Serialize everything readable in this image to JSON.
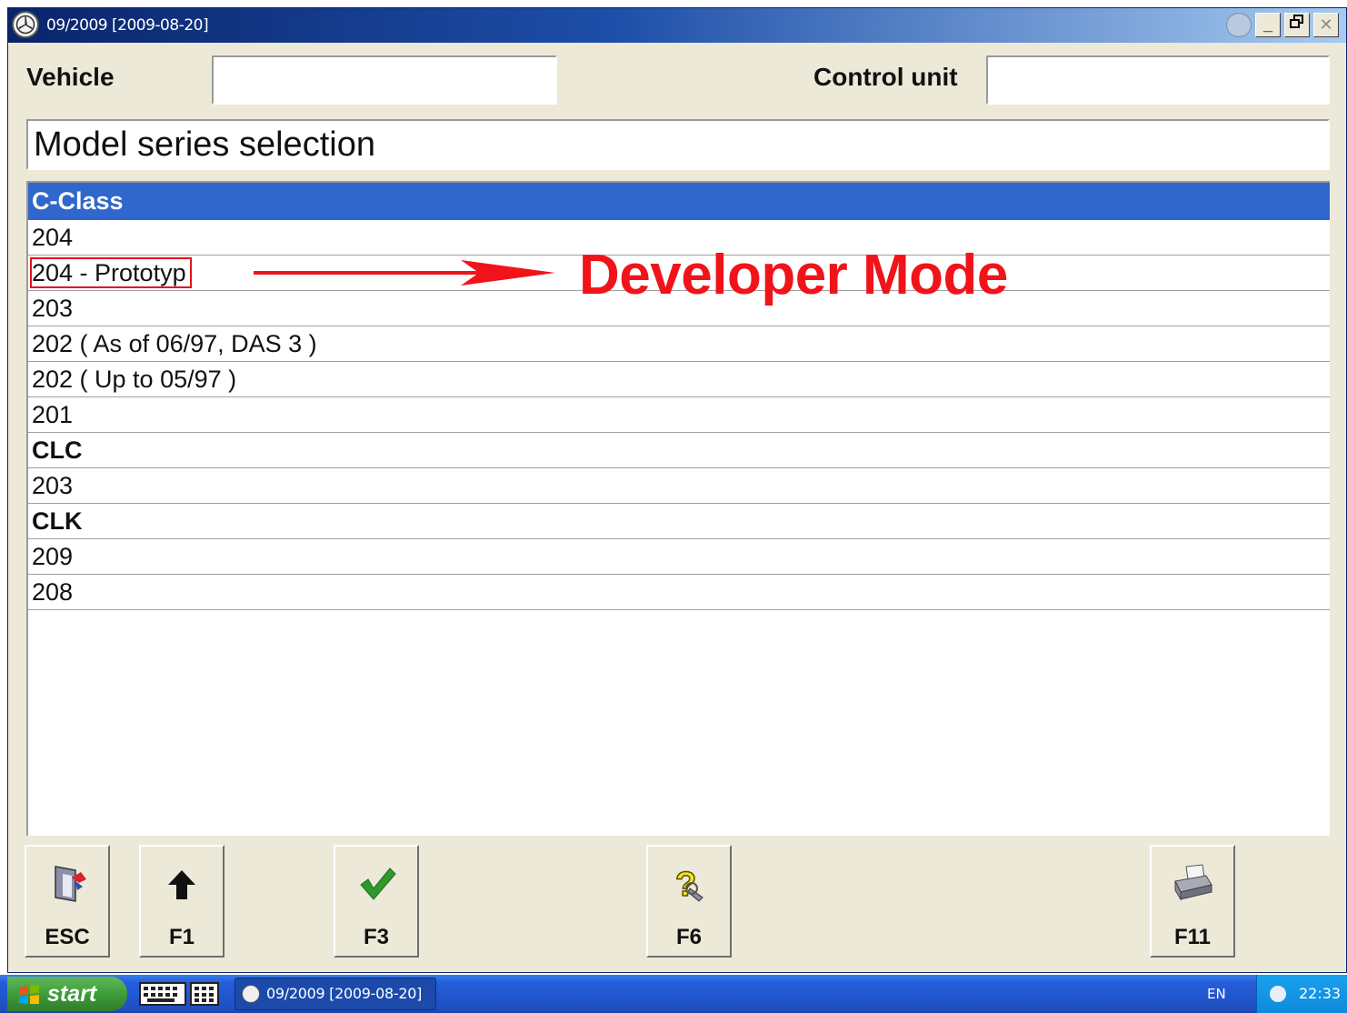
{
  "window": {
    "title": "09/2009 [2009-08-20]"
  },
  "header": {
    "vehicle_label": "Vehicle",
    "vehicle_value": "",
    "control_unit_label": "Control unit",
    "control_unit_value": ""
  },
  "heading": "Model series selection",
  "list": {
    "items": [
      {
        "label": "C-Class",
        "type": "group",
        "selected": true
      },
      {
        "label": "204",
        "type": "item"
      },
      {
        "label": "204 - Prototyp",
        "type": "item",
        "highlighted": true
      },
      {
        "label": "203",
        "type": "item"
      },
      {
        "label": "202 ( As of 06/97, DAS 3 )",
        "type": "item"
      },
      {
        "label": "202 ( Up to 05/97 )",
        "type": "item"
      },
      {
        "label": "201",
        "type": "item"
      },
      {
        "label": "CLC",
        "type": "group"
      },
      {
        "label": "203",
        "type": "item"
      },
      {
        "label": "CLK",
        "type": "group"
      },
      {
        "label": "209",
        "type": "item"
      },
      {
        "label": "208",
        "type": "item"
      }
    ]
  },
  "annotation": {
    "text": "Developer Mode",
    "color": "#f0141a"
  },
  "function_keys": [
    {
      "label": "ESC",
      "icon": "exit-door-icon"
    },
    {
      "label": "F1",
      "icon": "up-arrow-icon"
    },
    {
      "label": "F3",
      "icon": "checkmark-icon"
    },
    {
      "label": "F6",
      "icon": "help-question-icon"
    },
    {
      "label": "F11",
      "icon": "printer-icon"
    }
  ],
  "taskbar": {
    "start_label": "start",
    "task_label": "09/2009 [2009-08-20]",
    "language": "EN",
    "clock": "22:33"
  },
  "colors": {
    "selection": "#2f67cc",
    "window_bg": "#ece9d8",
    "taskbar": "#245edb"
  }
}
